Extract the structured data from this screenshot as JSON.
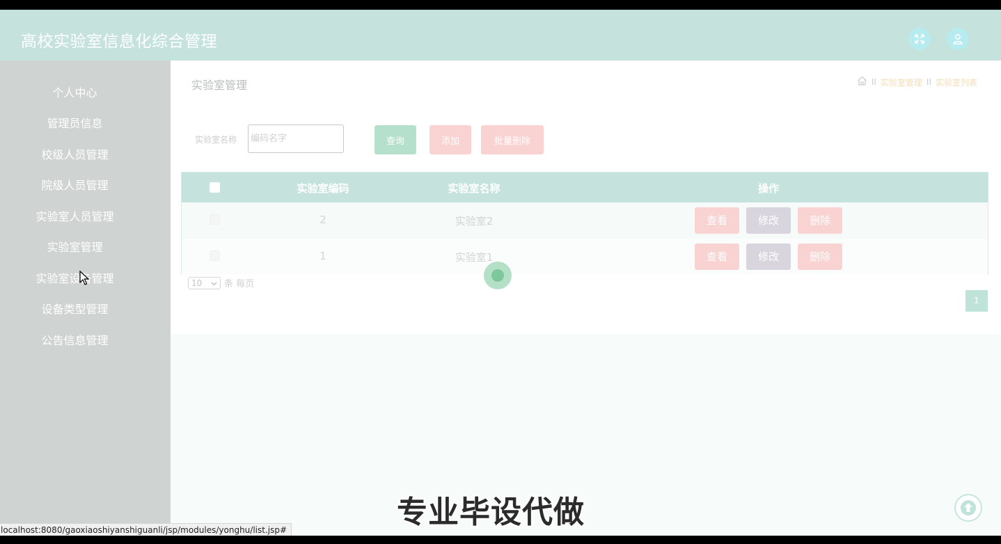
{
  "app": {
    "title": "高校实验室信息化综合管理"
  },
  "header": {
    "fullscreen_icon": "fullscreen-icon",
    "user_icon": "user-icon"
  },
  "sidebar": {
    "items": [
      {
        "label": "个人中心"
      },
      {
        "label": "管理员信息"
      },
      {
        "label": "校级人员管理"
      },
      {
        "label": "院级人员管理"
      },
      {
        "label": "实验室人员管理"
      },
      {
        "label": "实验室管理"
      },
      {
        "label": "实验室设备管理"
      },
      {
        "label": "设备类型管理"
      },
      {
        "label": "公告信息管理"
      }
    ]
  },
  "page": {
    "title": "实验室管理",
    "breadcrumb": [
      "实验室管理",
      "实验室列表"
    ]
  },
  "search": {
    "label": "实验室名称",
    "placeholder": "编码名字",
    "value": ""
  },
  "toolbar": {
    "query_label": "查询",
    "add_label": "添加",
    "batch_delete_label": "批量删除"
  },
  "table": {
    "columns": [
      "实验室编码",
      "实验室名称",
      "操作"
    ],
    "rows": [
      {
        "code": "2",
        "name": "实验室2"
      },
      {
        "code": "1",
        "name": "实验室1"
      }
    ],
    "actions": {
      "view": "查看",
      "edit": "修改",
      "delete": "删除"
    }
  },
  "pagination": {
    "page_size": "10",
    "page_size_suffix": "条 每页",
    "current_page": "1"
  },
  "overlay": {
    "watermark": "专业毕设代做",
    "status_url": "localhost:8080/gaoxiaoshiyanshiguanli/jsp/modules/yonghu/list.jsp#"
  },
  "colors": {
    "header_bg": "#c5e3dc",
    "sidebar_bg": "#cfd3d2",
    "query_btn": "#b5e0cc",
    "add_btn": "#f9d2d2",
    "delete_btn": "#f9d2d2",
    "edit_btn": "#d9d5df",
    "breadcrumb_text": "#f6ddb7"
  }
}
